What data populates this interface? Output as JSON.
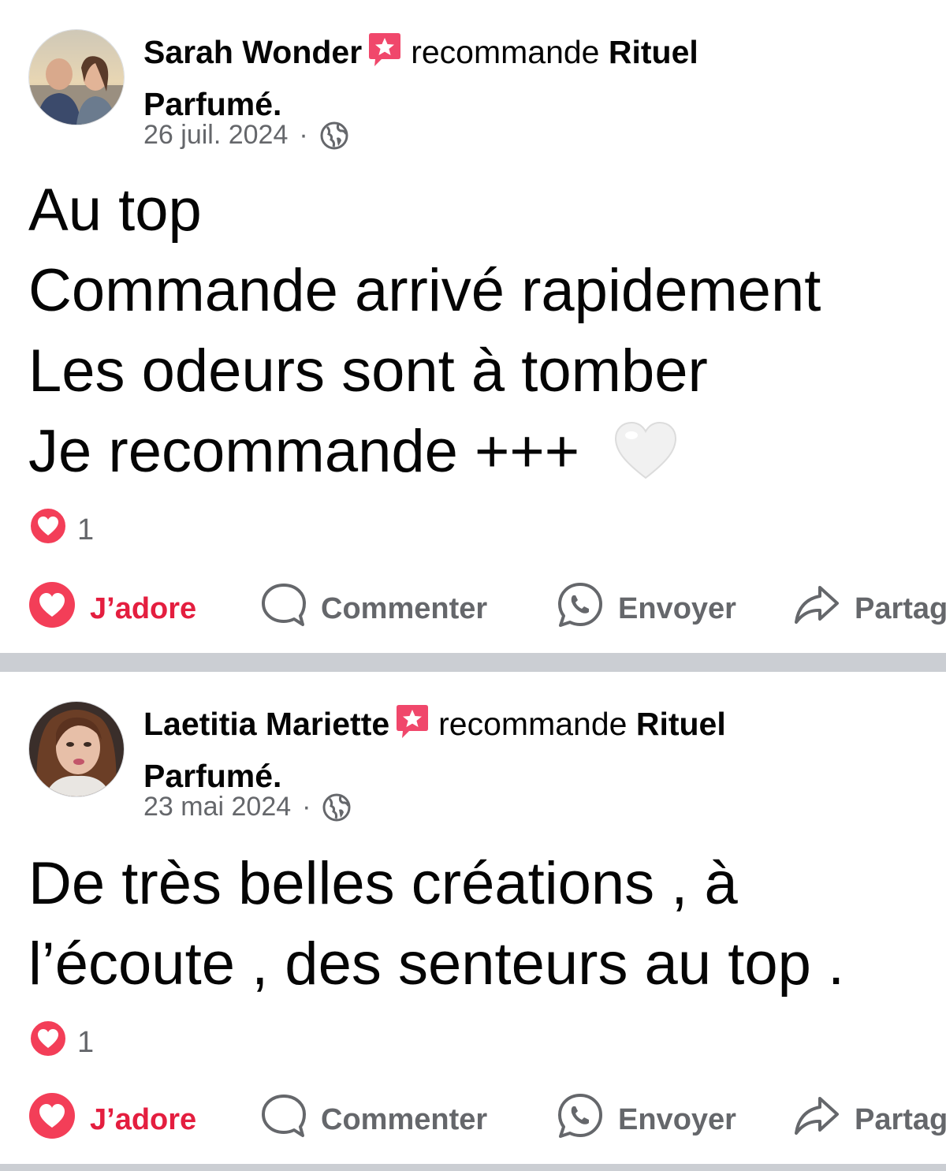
{
  "posts": [
    {
      "author": "Sarah Wonder",
      "action_text": "recommande",
      "page_name_part1": "Rituel",
      "page_name_part2": "Parfumé.",
      "date": "26 juil. 2024",
      "separator": "·",
      "privacy_icon": "globe-icon",
      "body_lines": [
        "Au top",
        "Commande arrivé rapidement",
        "Les odeurs sont à tomber",
        "Je recommande +++"
      ],
      "body_emoji": "white-heart-emoji",
      "reaction_count": "1",
      "actions": {
        "like": "J’adore",
        "comment": "Commenter",
        "send": "Envoyer",
        "share": "Partag"
      }
    },
    {
      "author": "Laetitia Mariette",
      "action_text": "recommande",
      "page_name_part1": "Rituel",
      "page_name_part2": "Parfumé.",
      "date": "23 mai 2024",
      "separator": "·",
      "privacy_icon": "globe-icon",
      "body_lines": [
        "De très belles créations , à",
        "l’écoute , des senteurs au top ."
      ],
      "reaction_count": "1",
      "actions": {
        "like": "J’adore",
        "comment": "Commenter",
        "send": "Envoyer",
        "share": "Partag"
      }
    }
  ],
  "colors": {
    "accent_red": "#e41e3f",
    "badge_pink": "#f0476b",
    "secondary_text": "#65676b",
    "separator": "#cbced3"
  }
}
